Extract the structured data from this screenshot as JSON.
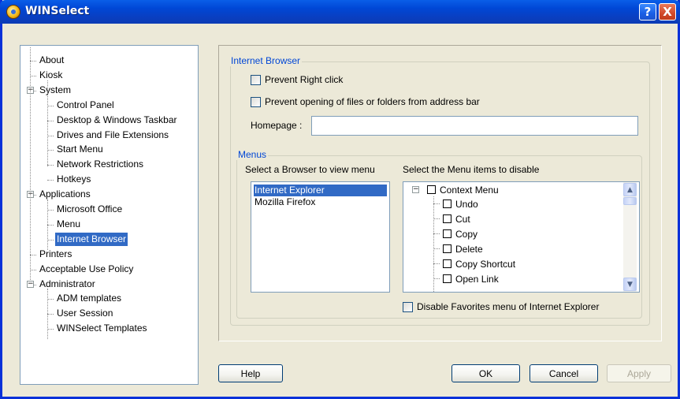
{
  "window": {
    "title": "WINSelect",
    "help_glyph": "?",
    "close_glyph": "X"
  },
  "tree": {
    "items": [
      {
        "label": "About"
      },
      {
        "label": "Kiosk"
      },
      {
        "label": "System",
        "expander": "−"
      },
      {
        "label": "Control Panel"
      },
      {
        "label": "Desktop & Windows Taskbar"
      },
      {
        "label": "Drives and File Extensions"
      },
      {
        "label": "Start Menu"
      },
      {
        "label": "Network Restrictions"
      },
      {
        "label": "Hotkeys"
      },
      {
        "label": "Applications",
        "expander": "−"
      },
      {
        "label": "Microsoft Office"
      },
      {
        "label": "Menu"
      },
      {
        "label": "Internet Browser",
        "selected": true
      },
      {
        "label": "Printers"
      },
      {
        "label": "Acceptable Use Policy"
      },
      {
        "label": "Administrator",
        "expander": "−"
      },
      {
        "label": "ADM templates"
      },
      {
        "label": "User Session"
      },
      {
        "label": "WINSelect Templates"
      }
    ]
  },
  "internet_browser": {
    "group_title": "Internet Browser",
    "prevent_right_click": "Prevent Right click",
    "prevent_opening": "Prevent opening of files or folders from address bar",
    "homepage_label": "Homepage :",
    "homepage_value": ""
  },
  "menus": {
    "group_title": "Menus",
    "browser_list_label": "Select a Browser to view menu",
    "menu_items_label": "Select the Menu items to disable",
    "browsers": [
      {
        "label": "Internet Explorer",
        "selected": true
      },
      {
        "label": "Mozilla Firefox",
        "selected": false
      }
    ],
    "context_menu_root": "Context Menu",
    "context_expander": "−",
    "context_items": [
      "Undo",
      "Cut",
      "Copy",
      "Delete",
      "Copy Shortcut",
      "Open Link"
    ],
    "disable_favorites": "Disable Favorites menu of Internet Explorer",
    "scroll_up": "▲",
    "scroll_down": "▼"
  },
  "buttons": {
    "help": "Help",
    "ok": "OK",
    "cancel": "Cancel",
    "apply": "Apply"
  },
  "colors": {
    "title_bar": "#0047d6",
    "selection": "#316ac5",
    "group_title": "#0046d5",
    "dialog_bg": "#ece9d8"
  }
}
